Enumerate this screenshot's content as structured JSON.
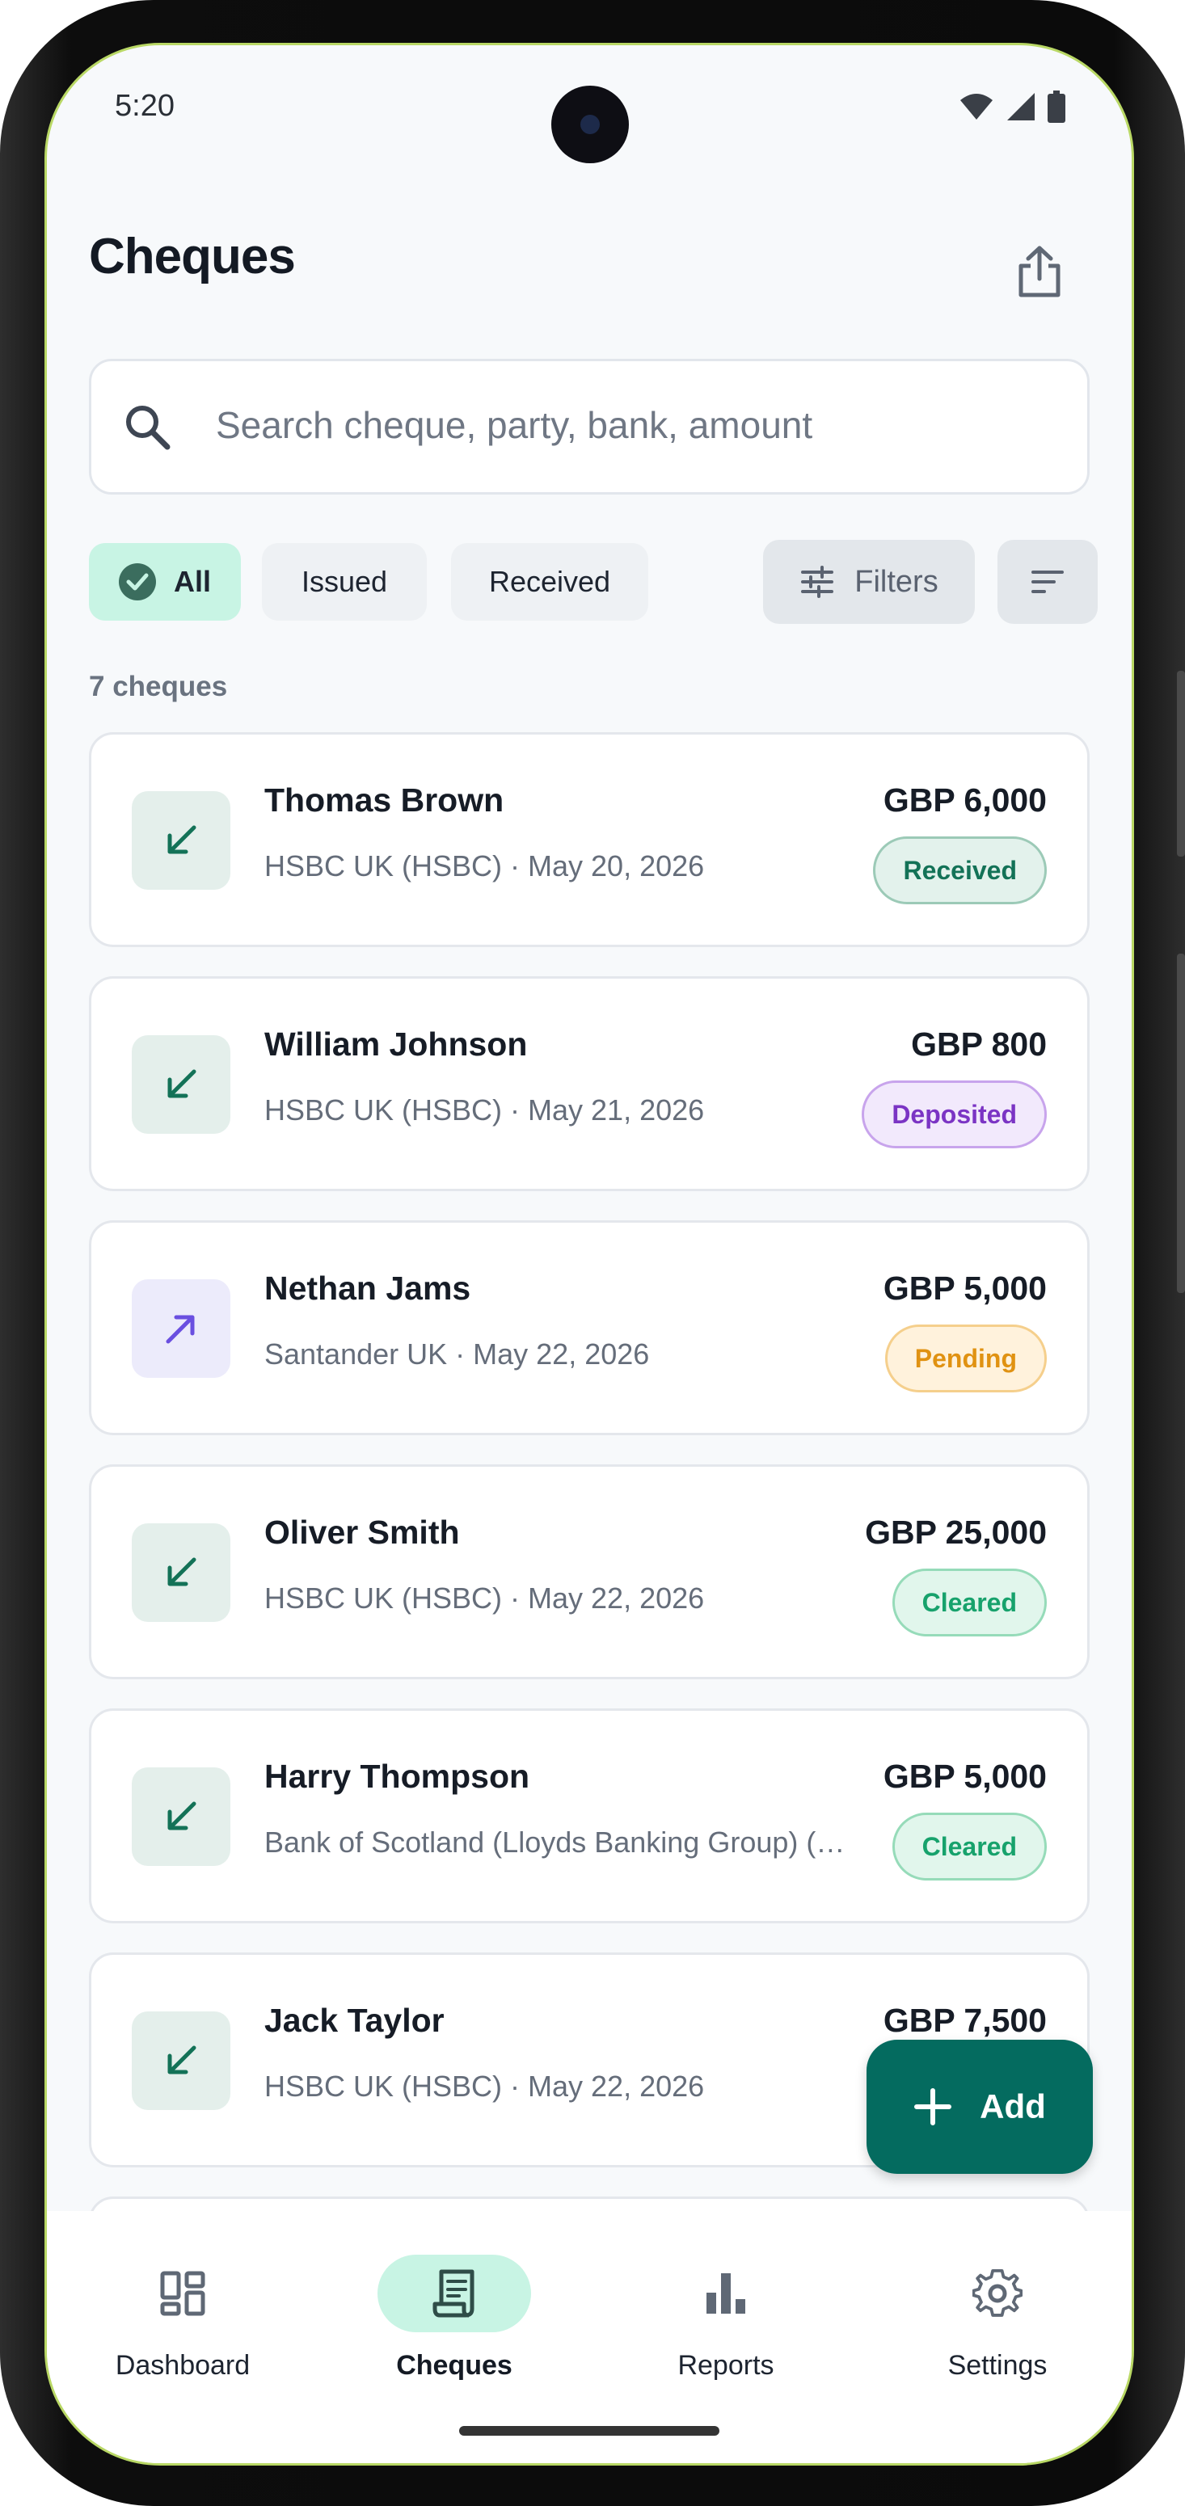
{
  "status_bar": {
    "time": "5:20"
  },
  "header": {
    "title": "Cheques"
  },
  "search": {
    "placeholder": "Search cheque, party, bank, amount"
  },
  "filters": {
    "chips": [
      "All",
      "Issued",
      "Received"
    ],
    "selected_chip": "All",
    "filters_label": "Filters"
  },
  "list": {
    "count_label": "7 cheques",
    "cheques": [
      {
        "direction": "received",
        "name": "Thomas Brown",
        "bank_date": "HSBC UK (HSBC) · May 20, 2026",
        "amount": "GBP 6,000",
        "status": "Received"
      },
      {
        "direction": "received",
        "name": "William Johnson",
        "bank_date": "HSBC UK (HSBC) · May 21, 2026",
        "amount": "GBP 800",
        "status": "Deposited"
      },
      {
        "direction": "issued",
        "name": "Nethan Jams",
        "bank_date": "Santander UK · May 22, 2026",
        "amount": "GBP 5,000",
        "status": "Pending"
      },
      {
        "direction": "received",
        "name": "Oliver Smith",
        "bank_date": "HSBC UK (HSBC) · May 22, 2026",
        "amount": "GBP 25,000",
        "status": "Cleared"
      },
      {
        "direction": "received",
        "name": "Harry Thompson",
        "bank_date": "Bank of Scotland (Lloyds Banking Group) (…",
        "amount": "GBP 5,000",
        "status": "Cleared"
      },
      {
        "direction": "received",
        "name": "Jack Taylor",
        "bank_date": "HSBC UK (HSBC) · May 22, 2026",
        "amount": "GBP 7,500",
        "status": ""
      }
    ]
  },
  "fab": {
    "label": "Add"
  },
  "nav": {
    "items": [
      {
        "label": "Dashboard",
        "icon": "dashboard-icon"
      },
      {
        "label": "Cheques",
        "icon": "cheque-icon"
      },
      {
        "label": "Reports",
        "icon": "bar-chart-icon"
      },
      {
        "label": "Settings",
        "icon": "gear-icon"
      }
    ],
    "active": "Cheques"
  },
  "colors": {
    "accent": "#046b5f",
    "chip_selected": "#c8f4e4",
    "received": "#137257",
    "deposited": "#7b34c4",
    "pending": "#e09212",
    "cleared": "#17a26c",
    "issued_arrow": "#6a4fe0"
  }
}
